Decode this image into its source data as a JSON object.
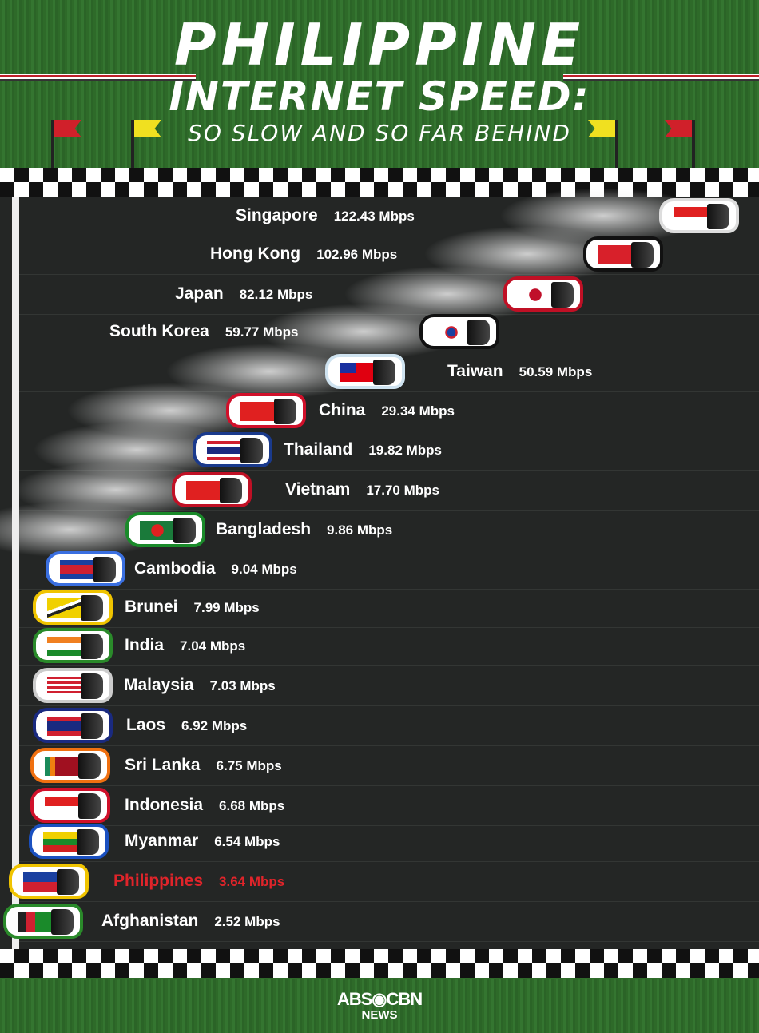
{
  "header": {
    "title_line1": "PHILIPPINE",
    "title_line2": "INTERNET SPEED:",
    "subtitle": "SO SLOW AND SO FAR BEHIND"
  },
  "footer": {
    "logo_main": "ABS◉CBN",
    "logo_sub": "NEWS"
  },
  "chart_data": {
    "type": "bar",
    "unit": "Mbps",
    "highlight": "Philippines",
    "highlight_color": "#e0242a",
    "categories": [
      "Singapore",
      "Hong Kong",
      "Japan",
      "South Korea",
      "Taiwan",
      "China",
      "Thailand",
      "Vietnam",
      "Bangladesh",
      "Cambodia",
      "Brunei",
      "India",
      "Malaysia",
      "Laos",
      "Sri Lanka",
      "Indonesia",
      "Myanmar",
      "Philippines",
      "Afghanistan"
    ],
    "values": [
      122.43,
      102.96,
      82.12,
      59.77,
      50.59,
      29.34,
      19.82,
      17.7,
      9.86,
      9.04,
      7.99,
      7.04,
      7.03,
      6.92,
      6.75,
      6.68,
      6.54,
      3.64,
      2.52
    ],
    "labels": [
      "122.43 Mbps",
      "102.96 Mbps",
      "82.12  Mbps",
      "59.77 Mbps",
      "50.59 Mbps",
      "29.34 Mbps",
      "19.82 Mbps",
      "17.70 Mbps",
      "9.86 Mbps",
      "9.04 Mbps",
      "7.99 Mbps",
      "7.04 Mbps",
      "7.03 Mbps",
      "6.92 Mbps",
      "6.75 Mbps",
      "6.68 Mbps",
      "6.54 Mbps",
      "3.64 Mbps",
      "2.52 Mbps"
    ],
    "car_colors": [
      "#dddddd",
      "#111111",
      "#c01025",
      "#111111",
      "#cfe3f0",
      "#d0102a",
      "#1a3a8c",
      "#c01025",
      "#1a8a2a",
      "#3a6fe0",
      "#f0c400",
      "#2a8a2a",
      "#cccccc",
      "#1a2a80",
      "#f07010",
      "#d0102a",
      "#1a50c0",
      "#f0c400",
      "#2a8a2a"
    ]
  }
}
